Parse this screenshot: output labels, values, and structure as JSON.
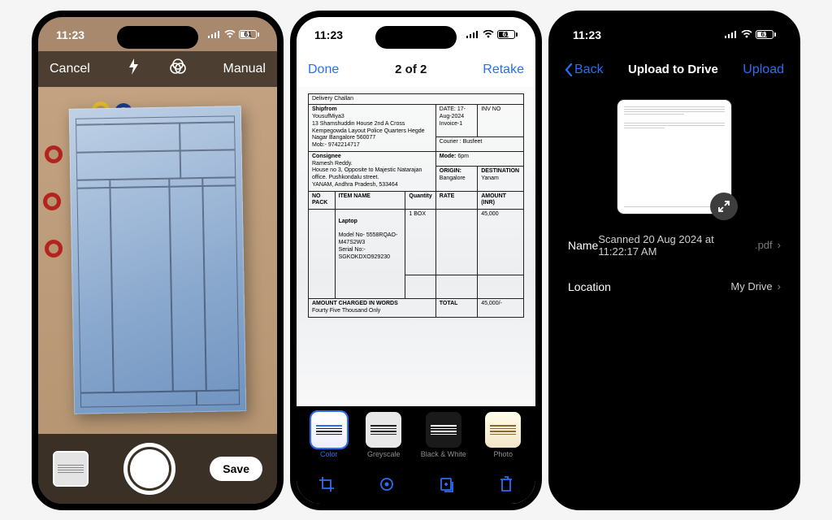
{
  "status": {
    "time": "11:23",
    "battery": "61"
  },
  "screen1": {
    "cancel": "Cancel",
    "mode": "Manual",
    "save": "Save"
  },
  "screen2": {
    "done": "Done",
    "counter": "2 of 2",
    "retake": "Retake",
    "filters": {
      "color": "Color",
      "greyscale": "Greyscale",
      "bw": "Black & White",
      "photo": "Photo"
    },
    "doc": {
      "heading": "Delivery Challan",
      "ship_from_label": "Shipfrom",
      "ship_from": "YousufMiya3\n13 Shamshuddin House 2nd A Cross\nKempegowda Layout Police Quarters Hegde\nNagar Bangalore 560077\nMob:- 9742214717",
      "date_label": "DATE:",
      "date": "17-Aug-2024",
      "invoice_label": "Invoice-1",
      "inv_no": "INV NO",
      "courier_label": "Courier :",
      "courier": "Busfeet",
      "consignee_label": "Consignee",
      "consignee": "Ramesh Reddy.\nHouse no 3, Opposite to Majestic Natarajan\noffice. Pushkondalu street.\nYANAM, Andhra Pradesh, 533464",
      "mode_label": "Mode:",
      "mode": "6pm",
      "origin_label": "ORIGIN:",
      "origin": "Bangalore",
      "dest_label": "DESTINATION",
      "dest": "Yanam",
      "cols": {
        "no": "NO PACK",
        "item": "ITEM NAME",
        "qty": "Quantity",
        "rate": "RATE",
        "amount": "AMOUNT (INR)"
      },
      "row": {
        "qty": "1 BOX",
        "item_line": "Laptop",
        "amount": "45,000",
        "model": "Model No- 5558RQAO-M47S2W3",
        "serial": "Serial No:- SGKOKDXO929230"
      },
      "amount_words_label": "AMOUNT CHARGED IN WORDS",
      "amount_words": "Fourty Five Thousand Only",
      "total_label": "TOTAL",
      "total": "45,000/-"
    }
  },
  "screen3": {
    "back": "Back",
    "title": "Upload to Drive",
    "upload": "Upload",
    "name_label": "Name",
    "name_value": "Scanned 20 Aug 2024 at 11:22:17 AM",
    "name_ext": ".pdf",
    "location_label": "Location",
    "location_value": "My Drive"
  }
}
